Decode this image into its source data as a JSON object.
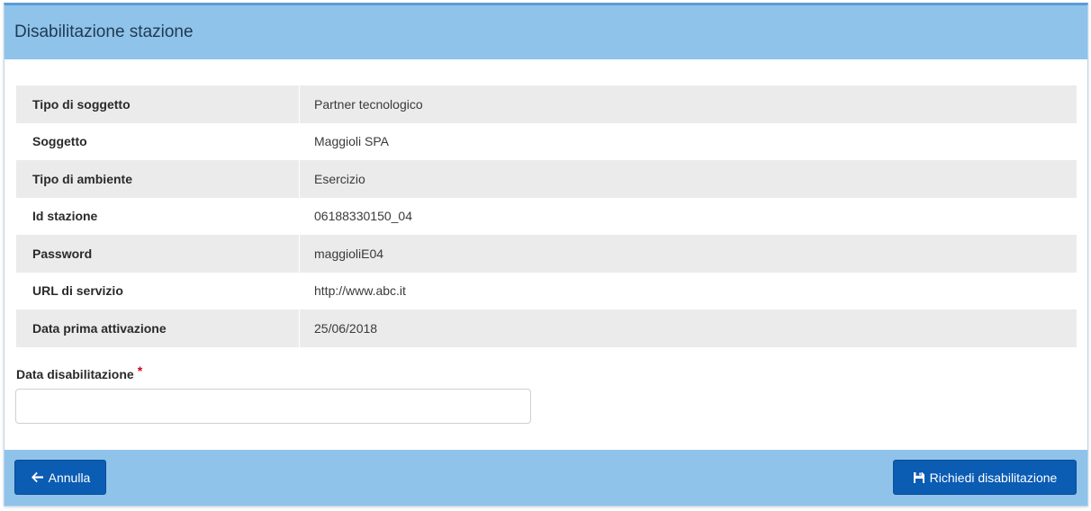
{
  "header": {
    "title": "Disabilitazione stazione"
  },
  "details": [
    {
      "label": "Tipo di soggetto",
      "value": "Partner tecnologico"
    },
    {
      "label": "Soggetto",
      "value": "Maggioli SPA"
    },
    {
      "label": "Tipo di ambiente",
      "value": "Esercizio"
    },
    {
      "label": "Id stazione",
      "value": "06188330150_04"
    },
    {
      "label": "Password",
      "value": "maggioliE04"
    },
    {
      "label": "URL di servizio",
      "value": "http://www.abc.it"
    },
    {
      "label": "Data prima attivazione",
      "value": "25/06/2018"
    }
  ],
  "form": {
    "date_label": "Data disabilitazione",
    "required_marker": "*",
    "date_value": "",
    "date_placeholder": ""
  },
  "footer": {
    "cancel_label": "Annulla",
    "cancel_icon": "arrow-left-icon",
    "submit_label": "Richiedi disabilitazione",
    "submit_icon": "save-icon"
  },
  "colors": {
    "header_bg": "#8fc3ea",
    "button_bg": "#0b5cb3",
    "row_alt_bg": "#ebebeb",
    "required": "#d0021b"
  }
}
